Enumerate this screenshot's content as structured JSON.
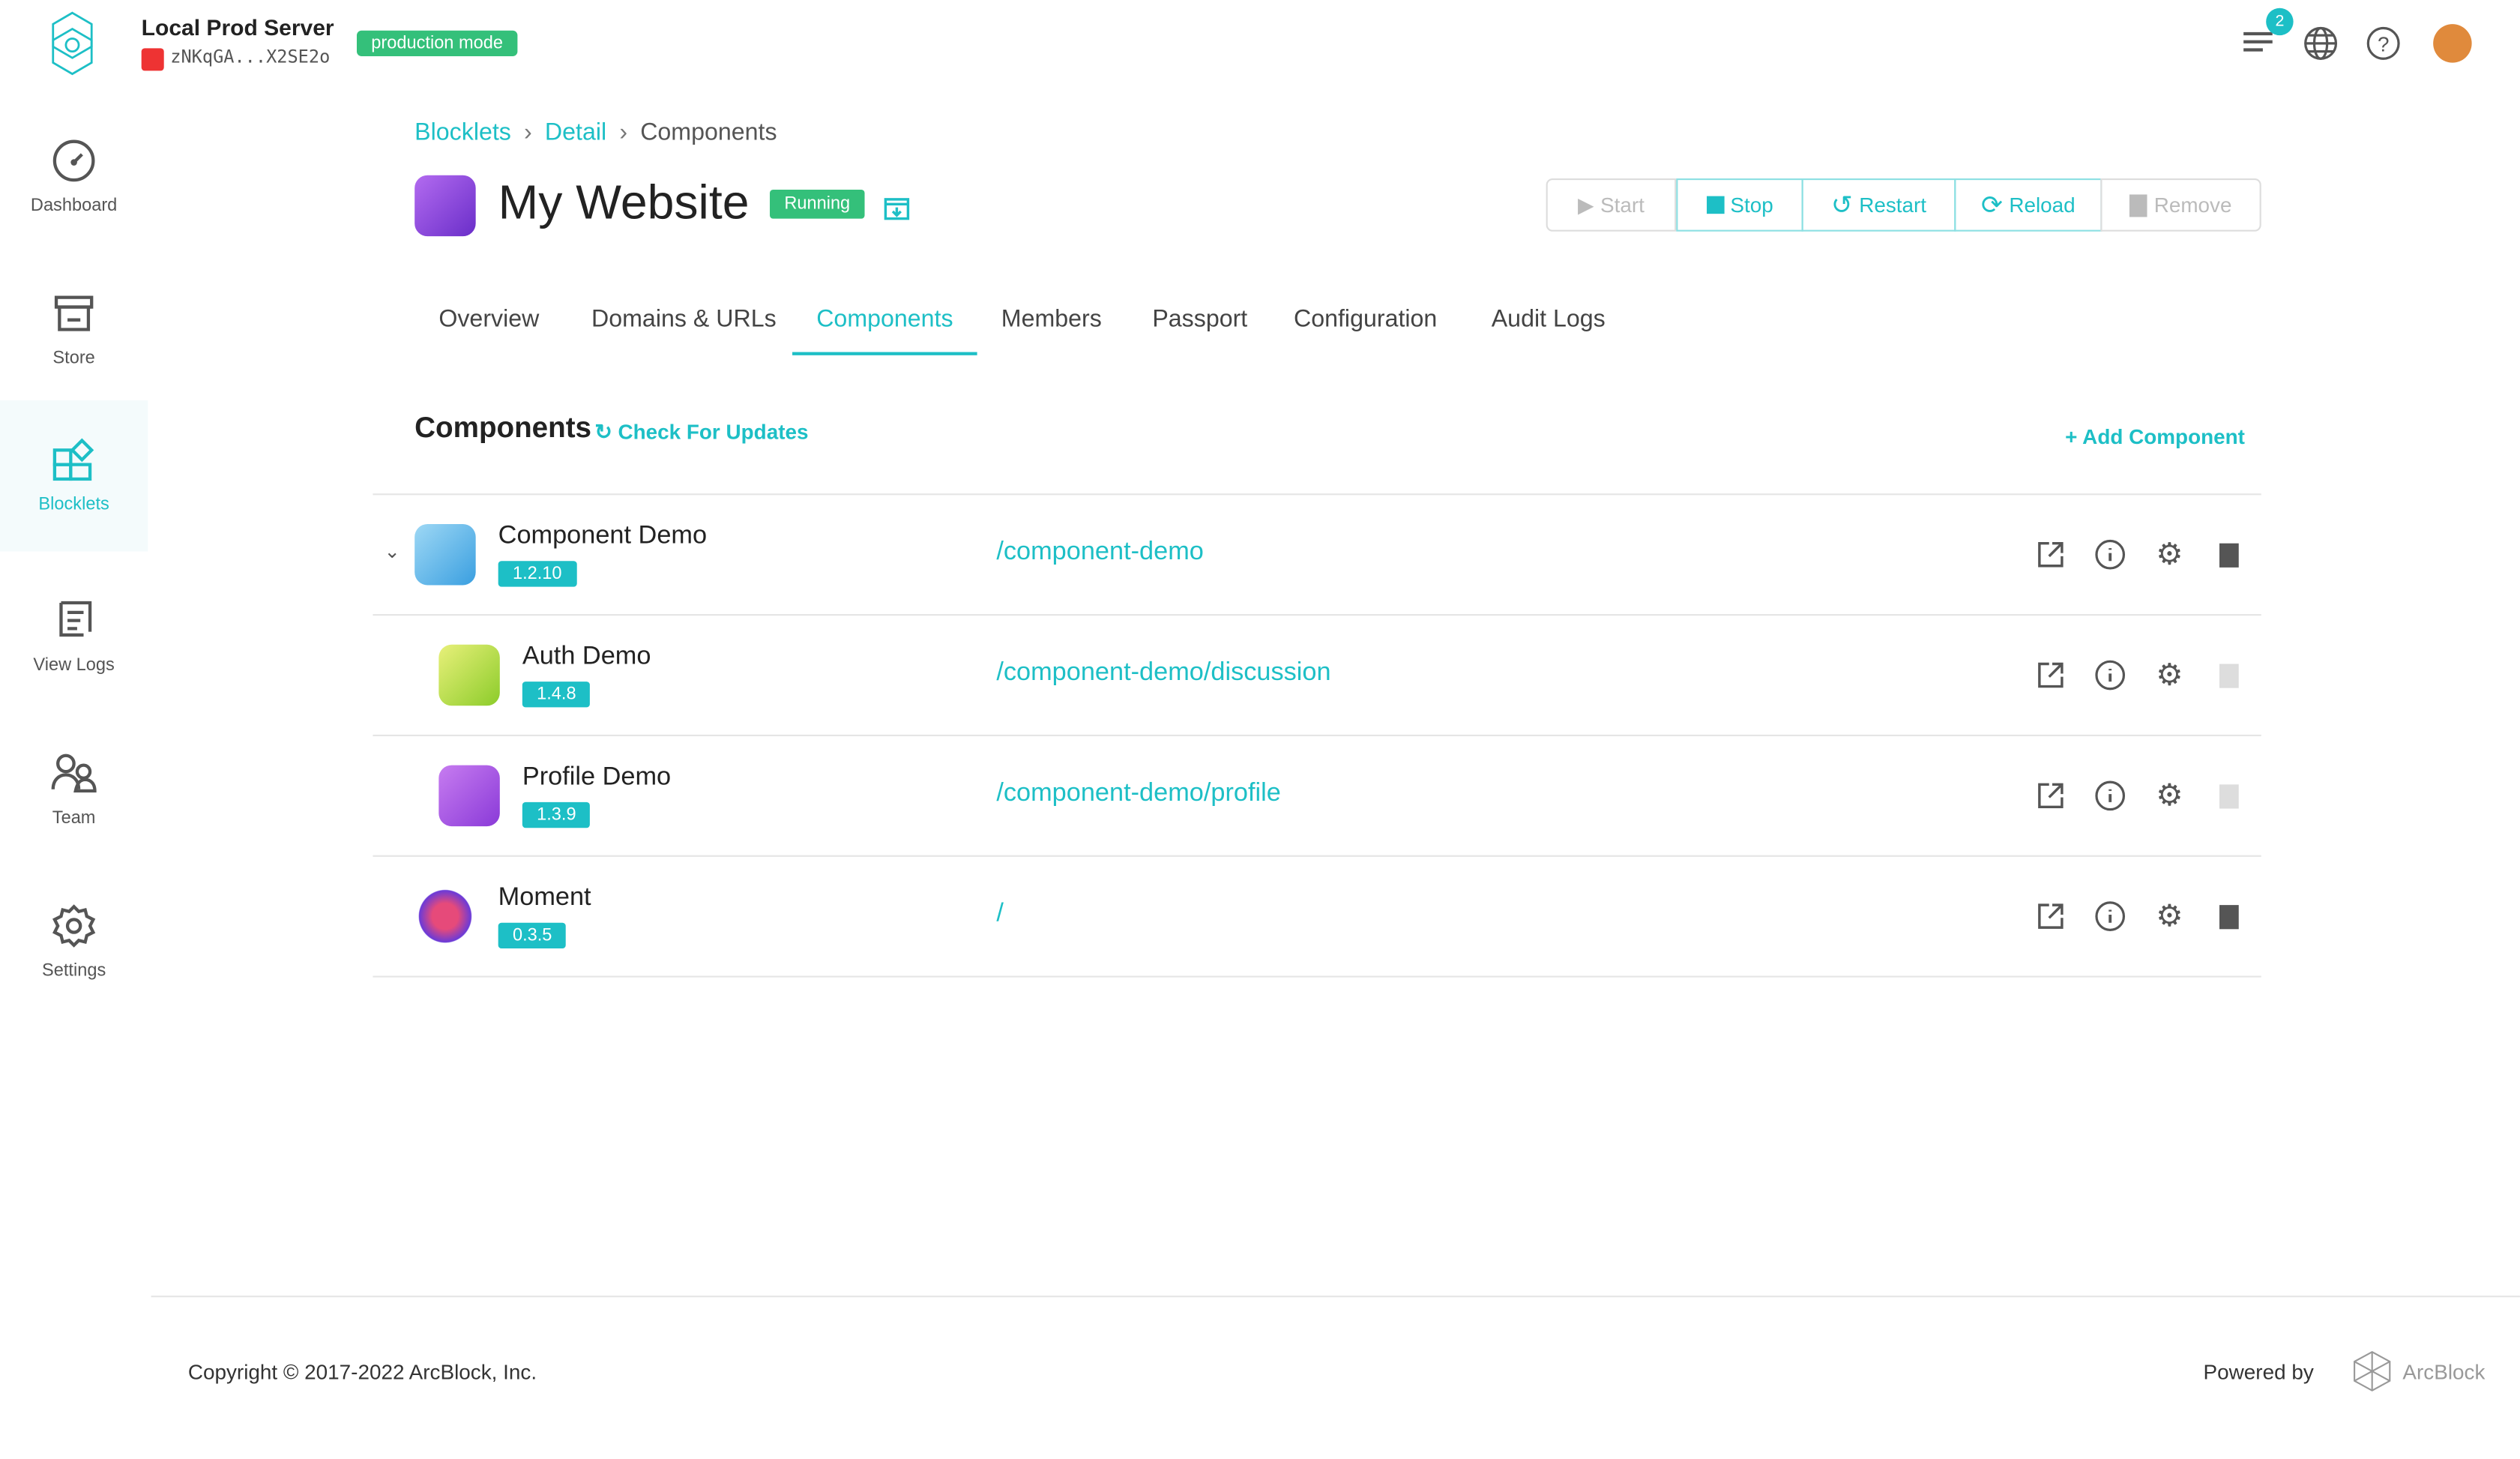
{
  "header": {
    "server_name": "Local Prod Server",
    "server_did": "zNKqGA...X2SE2o",
    "mode_badge": "production mode",
    "notification_count": "2"
  },
  "sidebar": {
    "items": [
      {
        "label": "Dashboard"
      },
      {
        "label": "Store"
      },
      {
        "label": "Blocklets"
      },
      {
        "label": "View Logs"
      },
      {
        "label": "Team"
      },
      {
        "label": "Settings"
      }
    ]
  },
  "breadcrumb": {
    "items": [
      "Blocklets",
      "Detail",
      "Components"
    ],
    "sep": "›"
  },
  "blocklet": {
    "title": "My Website",
    "status": "Running"
  },
  "actions": {
    "start": "Start",
    "stop": "Stop",
    "restart": "Restart",
    "reload": "Reload",
    "remove": "Remove"
  },
  "tabs": [
    "Overview",
    "Domains & URLs",
    "Components",
    "Members",
    "Passport",
    "Configuration",
    "Audit Logs"
  ],
  "components": {
    "title": "Components",
    "check_updates": "Check For Updates",
    "add": "Add Component",
    "rows": [
      {
        "name": "Component Demo",
        "version": "1.2.10",
        "path": "/component-demo"
      },
      {
        "name": "Auth Demo",
        "version": "1.4.8",
        "path": "/component-demo/discussion"
      },
      {
        "name": "Profile Demo",
        "version": "1.3.9",
        "path": "/component-demo/profile"
      },
      {
        "name": "Moment",
        "version": "0.3.5",
        "path": "/"
      }
    ]
  },
  "footer": {
    "copyright": "Copyright © 2017-2022  ArcBlock, Inc.",
    "powered_by": "Powered by",
    "brand": "ArcBlock"
  },
  "colors": {
    "accent": "#1dbfc6",
    "success": "#34c07a"
  }
}
